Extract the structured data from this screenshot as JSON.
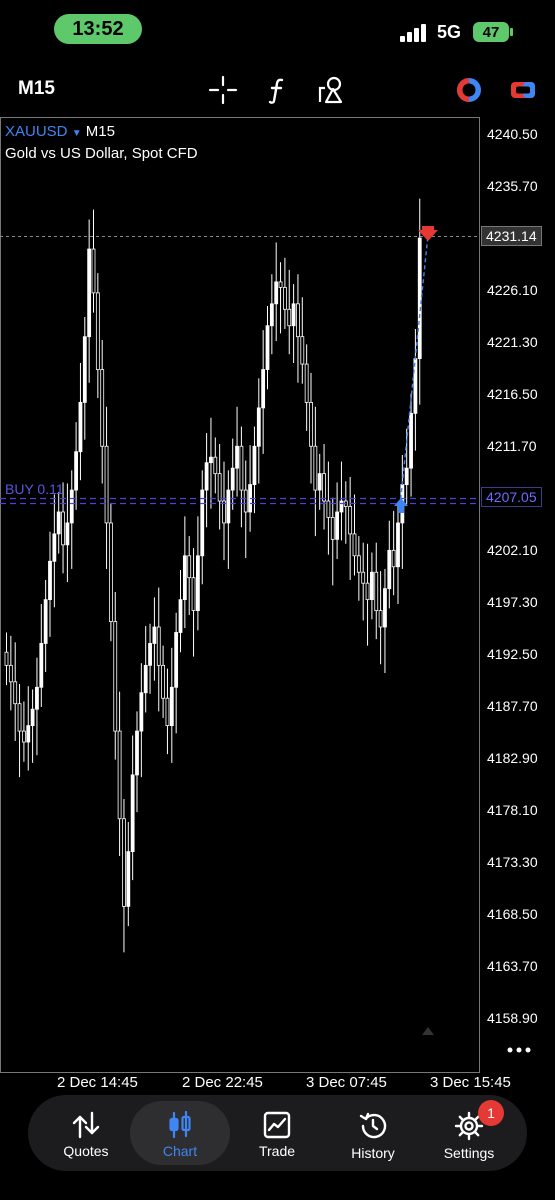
{
  "status_bar": {
    "time": "13:52",
    "network": "5G",
    "battery": "47"
  },
  "toolbar": {
    "timeframe": "M15",
    "icons": [
      "crosshair-icon",
      "function-icon",
      "objects-icon",
      "indicator-icon",
      "account-icon"
    ]
  },
  "chart": {
    "symbol": "XAUUSD",
    "dropdown_arrow": "▼",
    "timeframe": "M15",
    "description": "Gold vs US Dollar, Spot CFD",
    "price_axis": [
      "4240.50",
      "4235.70",
      "4226.10",
      "4221.30",
      "4216.50",
      "4211.70",
      "4202.10",
      "4197.30",
      "4192.50",
      "4187.70",
      "4182.90",
      "4178.10",
      "4173.30",
      "4168.50",
      "4163.70",
      "4158.90"
    ],
    "current_price_tag": "4231.14",
    "order_price_tag": "4207.05",
    "order_label": "BUY 0.11",
    "time_axis": [
      "2 Dec 14:45",
      "2 Dec 22:45",
      "3 Dec 07:45",
      "3 Dec 15:45"
    ],
    "colors": {
      "candles": "#ffffff",
      "order_line": "#4a44d6",
      "bid_line": "#8a8a8a",
      "buy_arrow": "#3f86f5",
      "sell_arrow": "#e53935",
      "trade_line": "#3f86f5"
    }
  },
  "chart_data": {
    "type": "candlestick",
    "symbol": "XAUUSD",
    "timeframe": "M15",
    "ylim": [
      4158.9,
      4240.5
    ],
    "x_ticks": [
      "2 Dec 14:45",
      "2 Dec 22:45",
      "3 Dec 07:45",
      "3 Dec 15:45"
    ],
    "current_price": 4231.14,
    "buy_order_price": 4207.05,
    "closes": [
      4192.0,
      4190.5,
      4188.5,
      4186.0,
      4185.0,
      4186.5,
      4188.0,
      4190.0,
      4194.0,
      4198.0,
      4201.5,
      4204.0,
      4206.0,
      4203.0,
      4205.0,
      4208.0,
      4211.5,
      4216.0,
      4222.0,
      4230.0,
      4226.0,
      4219.0,
      4212.0,
      4205.0,
      4196.0,
      4186.0,
      4178.0,
      4170.0,
      4175.0,
      4182.0,
      4186.0,
      4189.5,
      4192.0,
      4194.0,
      4195.5,
      4192.0,
      4189.0,
      4186.5,
      4190.0,
      4195.0,
      4198.0,
      4202.0,
      4200.0,
      4197.0,
      4202.0,
      4208.0,
      4210.5,
      4211.0,
      4209.5,
      4207.0,
      4205.0,
      4208.0,
      4210.0,
      4212.0,
      4208.0,
      4206.0,
      4208.5,
      4212.0,
      4215.5,
      4219.0,
      4223.0,
      4225.0,
      4227.0,
      4226.5,
      4224.5,
      4223.0,
      4225.0,
      4222.0,
      4219.5,
      4216.0,
      4212.0,
      4208.0,
      4209.5,
      4207.0,
      4205.5,
      4203.5,
      4206.0,
      4207.0,
      4206.5,
      4204.0,
      4202.0,
      4200.5,
      4199.5,
      4198.0,
      4200.5,
      4197.0,
      4195.5,
      4199.0,
      4202.5,
      4201.0,
      4205.0,
      4208.5,
      4210.0,
      4215.0,
      4220.0,
      4231.0
    ]
  },
  "bottom_nav": {
    "items": [
      {
        "label": "Quotes",
        "icon": "quotes-icon",
        "active": false
      },
      {
        "label": "Chart",
        "icon": "chart-icon",
        "active": true
      },
      {
        "label": "Trade",
        "icon": "trade-icon",
        "active": false
      },
      {
        "label": "History",
        "icon": "history-icon",
        "active": false
      },
      {
        "label": "Settings",
        "icon": "settings-icon",
        "active": false
      }
    ],
    "settings_badge": "1"
  }
}
